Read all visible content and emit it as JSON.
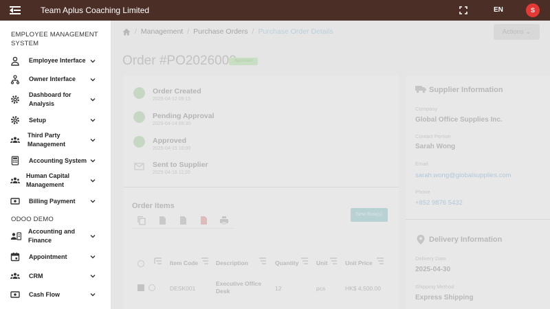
{
  "topbar": {
    "title": "Team Aplus Coaching Limited",
    "language": "EN",
    "avatar_initial": "S",
    "colors": {
      "bar": "#4b2e26",
      "avatar": "#e53935"
    }
  },
  "sidebar": {
    "section1": "EMPLOYEE MANAGEMENT SYSTEM",
    "items": [
      {
        "label": "Employee Interface",
        "icon": "person-icon"
      },
      {
        "label": "Owner Interface",
        "icon": "org-chart-icon"
      },
      {
        "label": "Dashboard for Analysis",
        "icon": "gear-icon"
      },
      {
        "label": "Setup",
        "icon": "gear-icon"
      },
      {
        "label": "Third Party Management",
        "icon": "group-icon"
      },
      {
        "label": "Accounting System",
        "icon": "calculator-icon"
      },
      {
        "label": "Human Capital Management",
        "icon": "group-icon"
      },
      {
        "label": "Billing Payment",
        "icon": "payment-icon"
      }
    ],
    "section2": "ODOO DEMO",
    "items2": [
      {
        "label": "Accounting and Finance",
        "icon": "contacts-icon"
      },
      {
        "label": "Appointment",
        "icon": "calendar-icon"
      },
      {
        "label": "CRM",
        "icon": "group-icon"
      },
      {
        "label": "Cash Flow",
        "icon": "payment-icon"
      }
    ]
  },
  "main": {
    "breadcrumb": [
      "Management",
      "Purchase Orders",
      "Purchase Order Details"
    ],
    "actions_label": "Actions",
    "order_title": "Order #PO2026002",
    "status_badge": "Approved",
    "steps": [
      {
        "title": "Order Created",
        "date": "2025-04-12 09:15"
      },
      {
        "title": "Pending Approval",
        "date": "2025-04-14 09:30"
      },
      {
        "title": "Approved",
        "date": "2025-04-15 10:00"
      },
      {
        "title": "Sent to Supplier",
        "date": "2025-04-16 11:20"
      }
    ],
    "order_items": {
      "title": "Order Items",
      "new_row_label": "New Row(s)",
      "columns": [
        "Item Code",
        "Description",
        "Quantity",
        "Unit",
        "Unit Price"
      ],
      "rows": [
        {
          "code": "DESK001",
          "description": "Executive Office Desk",
          "quantity": "12",
          "unit": "pcs",
          "price": "HK$ 4,500.00"
        }
      ]
    },
    "supplier": {
      "title": "Supplier Information",
      "company_label": "Company",
      "company": "Global Office Supplies Inc.",
      "contact_label": "Contact Person",
      "contact": "Sarah Wong",
      "email_label": "Email",
      "email": "sarah.wong@globalsupplies.com",
      "phone_label": "Phone",
      "phone": "+852 9876 5432"
    },
    "delivery": {
      "title": "Delivery Information",
      "date_label": "Delivery Date",
      "date": "2025-04-30",
      "method_label": "Shipping Method",
      "method": "Express Shipping"
    }
  }
}
